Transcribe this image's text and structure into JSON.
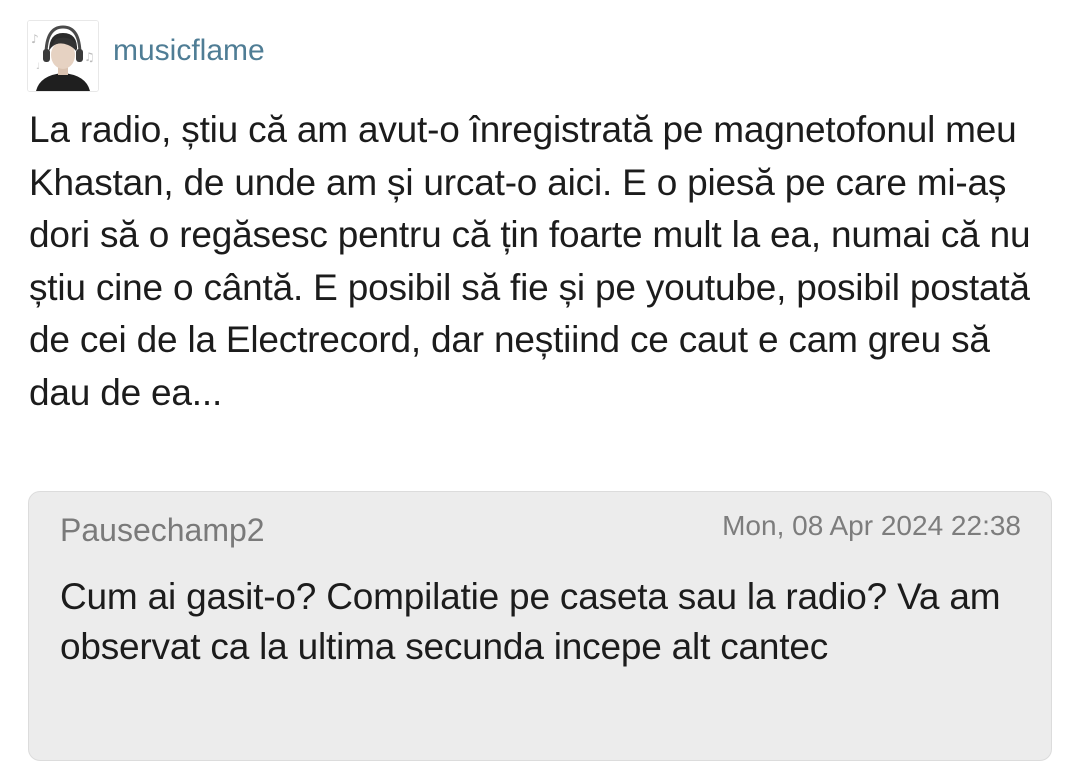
{
  "post": {
    "username": "musicflame",
    "avatar_icon": "avatar-headphones-icon",
    "text": "La radio, știu că am avut-o înregistrată pe magnetofonul meu Khastan, de unde am și urcat-o aici. E o piesă pe care mi-aș dori să o regăsesc pentru că țin foarte mult la ea, numai că nu știu cine o cântă. E posibil să fie și pe youtube, posibil postată de cei de la Electrecord, dar neștiind ce caut e cam greu să dau de ea..."
  },
  "reply": {
    "author": "Pausechamp2",
    "timestamp": "Mon, 08 Apr 2024 22:38",
    "text": "Cum ai gasit-o? Compilatie pe caseta sau la radio? Va am observat ca la ultima secunda incepe alt cantec"
  },
  "colors": {
    "username": "#4f7d95",
    "reply_background": "#ececec",
    "text": "#1c1c1c"
  }
}
